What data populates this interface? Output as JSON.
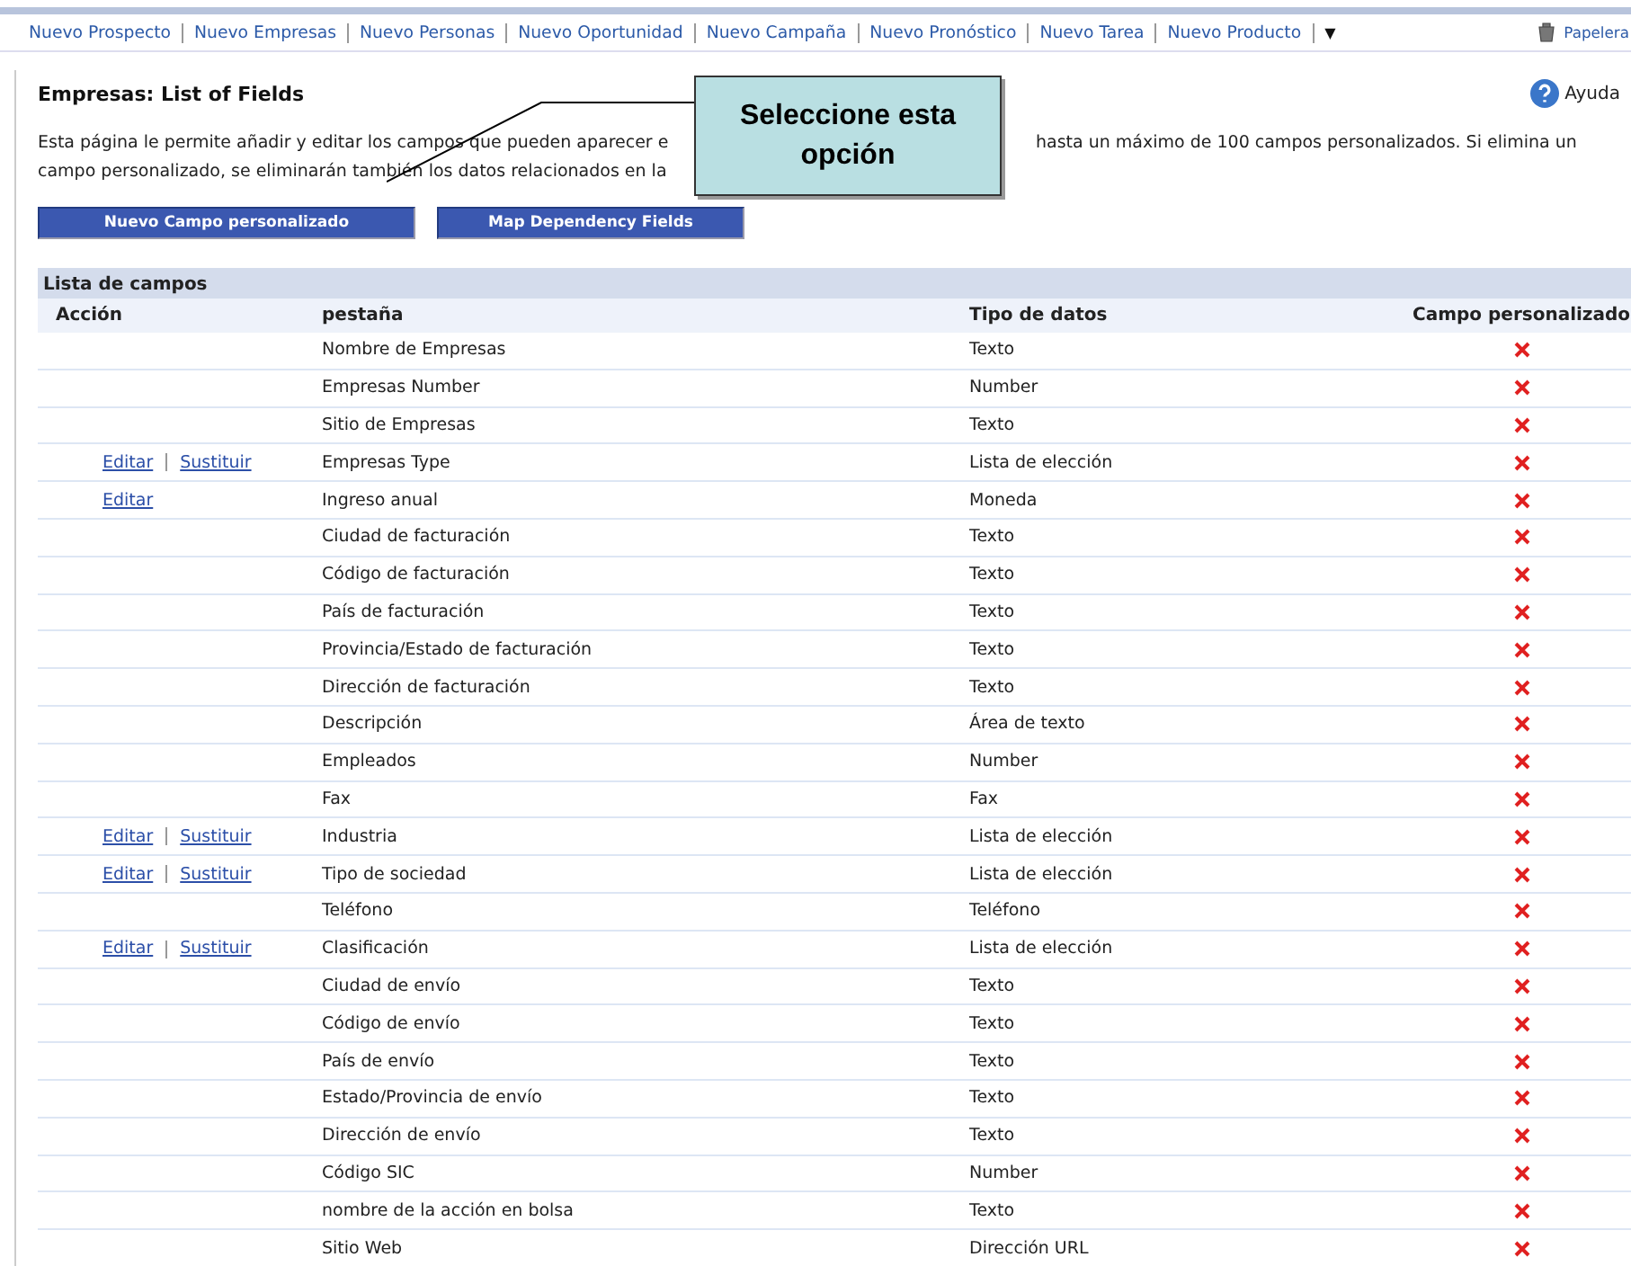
{
  "nav": {
    "items": [
      "Nuevo Prospecto",
      "Nuevo Empresas",
      "Nuevo Personas",
      "Nuevo Oportunidad",
      "Nuevo Campaña",
      "Nuevo Pronóstico",
      "Nuevo Tarea",
      "Nuevo Producto"
    ],
    "more": "▼",
    "recycle": "Papelera"
  },
  "page": {
    "title": "Empresas: List of Fields",
    "help": "Ayuda",
    "intro": {
      "line1_left": "Esta página le permite añadir y editar los campos que pueden aparecer e",
      "line1_right": "hasta un máximo de 100 campos personalizados. Si elimina un",
      "line2": "campo personalizado, se eliminarán también los datos relacionados en la"
    },
    "buttons": [
      "Nuevo Campo personalizado",
      "Map Dependency Fields"
    ]
  },
  "callout": {
    "text": "Seleccione esta opción"
  },
  "table": {
    "title": "Lista de campos",
    "columns": [
      "Acción",
      "pestaña",
      "Tipo de datos",
      "Campo personalizado"
    ],
    "rows": [
      {
        "actions": [],
        "name": "Nombre de Empresas",
        "type": "Texto",
        "custom": false
      },
      {
        "actions": [],
        "name": "Empresas Number",
        "type": "Number",
        "custom": false
      },
      {
        "actions": [],
        "name": "Sitio de Empresas",
        "type": "Texto",
        "custom": false
      },
      {
        "actions": [
          "Editar",
          "Sustituir"
        ],
        "name": "Empresas Type",
        "type": "Lista de elección",
        "custom": false
      },
      {
        "actions": [
          "Editar"
        ],
        "name": "Ingreso anual",
        "type": "Moneda",
        "custom": false
      },
      {
        "actions": [],
        "name": "Ciudad de facturación",
        "type": "Texto",
        "custom": false
      },
      {
        "actions": [],
        "name": "Código de facturación",
        "type": "Texto",
        "custom": false
      },
      {
        "actions": [],
        "name": "País de facturación",
        "type": "Texto",
        "custom": false
      },
      {
        "actions": [],
        "name": "Provincia/Estado de facturación",
        "type": "Texto",
        "custom": false
      },
      {
        "actions": [],
        "name": "Dirección de facturación",
        "type": "Texto",
        "custom": false
      },
      {
        "actions": [],
        "name": "Descripción",
        "type": "Área de texto",
        "custom": false
      },
      {
        "actions": [],
        "name": "Empleados",
        "type": "Number",
        "custom": false
      },
      {
        "actions": [],
        "name": "Fax",
        "type": "Fax",
        "custom": false
      },
      {
        "actions": [
          "Editar",
          "Sustituir"
        ],
        "name": "Industria",
        "type": "Lista de elección",
        "custom": false
      },
      {
        "actions": [
          "Editar",
          "Sustituir"
        ],
        "name": "Tipo de sociedad",
        "type": "Lista de elección",
        "custom": false
      },
      {
        "actions": [],
        "name": "Teléfono",
        "type": "Teléfono",
        "custom": false
      },
      {
        "actions": [
          "Editar",
          "Sustituir"
        ],
        "name": "Clasificación",
        "type": "Lista de elección",
        "custom": false
      },
      {
        "actions": [],
        "name": "Ciudad de envío",
        "type": "Texto",
        "custom": false
      },
      {
        "actions": [],
        "name": "Código de envío",
        "type": "Texto",
        "custom": false
      },
      {
        "actions": [],
        "name": "País de envío",
        "type": "Texto",
        "custom": false
      },
      {
        "actions": [],
        "name": "Estado/Provincia de envío",
        "type": "Texto",
        "custom": false
      },
      {
        "actions": [],
        "name": "Dirección de envío",
        "type": "Texto",
        "custom": false
      },
      {
        "actions": [],
        "name": "Código SIC",
        "type": "Number",
        "custom": false
      },
      {
        "actions": [],
        "name": "nombre de la acción en bolsa",
        "type": "Texto",
        "custom": false
      },
      {
        "actions": [],
        "name": "Sitio Web",
        "type": "Dirección URL",
        "custom": false
      }
    ]
  }
}
